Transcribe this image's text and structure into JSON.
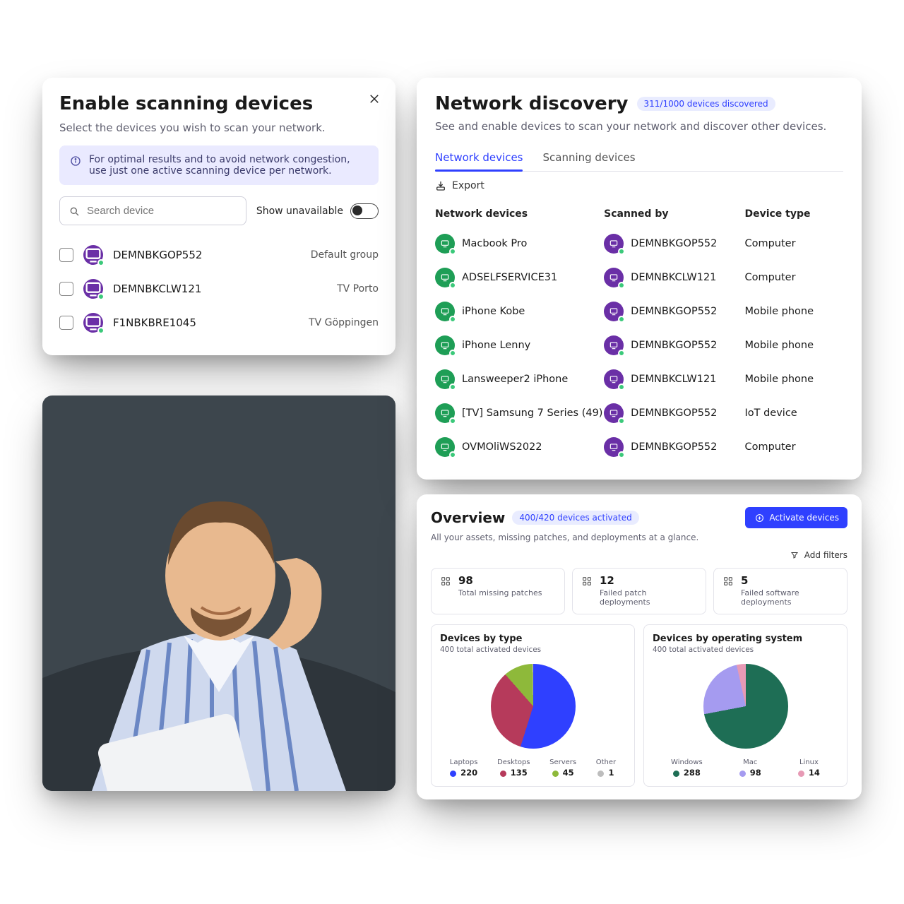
{
  "scan_card": {
    "title": "Enable scanning devices",
    "subtitle": "Select the devices you wish to scan your network.",
    "info": "For optimal results and to avoid network congestion, use just one active scanning device per network.",
    "search_placeholder": "Search device",
    "toggle_label": "Show unavailable",
    "devices": [
      {
        "name": "DEMNBKGOP552",
        "group": "Default group"
      },
      {
        "name": "DEMNBKCLW121",
        "group": "TV Porto"
      },
      {
        "name": "F1NBKBRE1045",
        "group": "TV Göppingen"
      }
    ]
  },
  "network_card": {
    "title": "Network discovery",
    "badge": "311/1000 devices discovered",
    "subtitle": "See and enable devices to scan your network and discover other devices.",
    "tabs": {
      "active": "Network devices",
      "other": "Scanning devices"
    },
    "export": "Export",
    "columns": {
      "c1": "Network devices",
      "c2": "Scanned by",
      "c3": "Device type"
    },
    "rows": [
      {
        "device": "Macbook Pro",
        "scanner": "DEMNBKGOP552",
        "type": "Computer"
      },
      {
        "device": "ADSELFSERVICE31",
        "scanner": "DEMNBKCLW121",
        "type": "Computer"
      },
      {
        "device": "iPhone Kobe",
        "scanner": "DEMNBKGOP552",
        "type": "Mobile phone"
      },
      {
        "device": "iPhone Lenny",
        "scanner": "DEMNBKGOP552",
        "type": "Mobile phone"
      },
      {
        "device": "Lansweeper2 iPhone",
        "scanner": "DEMNBKCLW121",
        "type": "Mobile phone"
      },
      {
        "device": "[TV] Samsung 7 Series (49)",
        "scanner": "DEMNBKGOP552",
        "type": "IoT device"
      },
      {
        "device": "OVMOliWS2022",
        "scanner": "DEMNBKGOP552",
        "type": "Computer"
      }
    ]
  },
  "overview_card": {
    "title": "Overview",
    "badge": "400/420 devices activated",
    "subtitle": "All your assets, missing patches, and deployments at a glance.",
    "activate_btn": "Activate devices",
    "add_filters": "Add filters",
    "kpis": [
      {
        "value": "98",
        "label": "Total missing patches"
      },
      {
        "value": "12",
        "label": "Failed patch deployments"
      },
      {
        "value": "5",
        "label": "Failed software deployments"
      }
    ],
    "chart1": {
      "title": "Devices by type",
      "sub": "400 total activated devices",
      "legend": [
        {
          "name": "Laptops",
          "value": "220",
          "color": "#2f40ff"
        },
        {
          "name": "Desktops",
          "value": "135",
          "color": "#b63a5b"
        },
        {
          "name": "Servers",
          "value": "45",
          "color": "#8eb93a"
        },
        {
          "name": "Other",
          "value": "1",
          "color": "#bdbdbd"
        }
      ]
    },
    "chart2": {
      "title": "Devices by operating system",
      "sub": "400 total activated devices",
      "legend": [
        {
          "name": "Windows",
          "value": "288",
          "color": "#1e6e55"
        },
        {
          "name": "Mac",
          "value": "98",
          "color": "#a59bf0"
        },
        {
          "name": "Linux",
          "value": "14",
          "color": "#e79ab5"
        }
      ]
    }
  },
  "chart_data": [
    {
      "type": "pie",
      "title": "Devices by type",
      "subtitle_note": "400 total activated devices",
      "series": [
        {
          "name": "Laptops",
          "value": 220,
          "color": "#2f40ff"
        },
        {
          "name": "Desktops",
          "value": 135,
          "color": "#b63a5b"
        },
        {
          "name": "Servers",
          "value": 45,
          "color": "#8eb93a"
        },
        {
          "name": "Other",
          "value": 1,
          "color": "#bdbdbd"
        }
      ]
    },
    {
      "type": "pie",
      "title": "Devices by operating system",
      "subtitle_note": "400 total activated devices",
      "series": [
        {
          "name": "Windows",
          "value": 288,
          "color": "#1e6e55"
        },
        {
          "name": "Mac",
          "value": 98,
          "color": "#a59bf0"
        },
        {
          "name": "Linux",
          "value": 14,
          "color": "#e79ab5"
        }
      ]
    }
  ]
}
